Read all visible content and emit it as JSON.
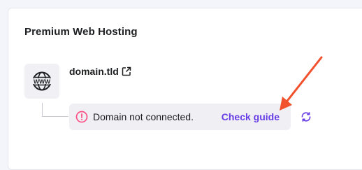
{
  "card": {
    "title": "Premium Web Hosting"
  },
  "domain": {
    "icon": "www-globe-icon",
    "name": "domain.tld",
    "external_link_icon": "external-link-icon"
  },
  "alert": {
    "icon": "alert-circle-icon",
    "message": "Domain not connected.",
    "action_label": "Check guide"
  },
  "refresh": {
    "icon": "refresh-icon"
  },
  "colors": {
    "accent": "#673de6",
    "alert_red": "#fc5185",
    "annotation_arrow": "#f2512e"
  }
}
